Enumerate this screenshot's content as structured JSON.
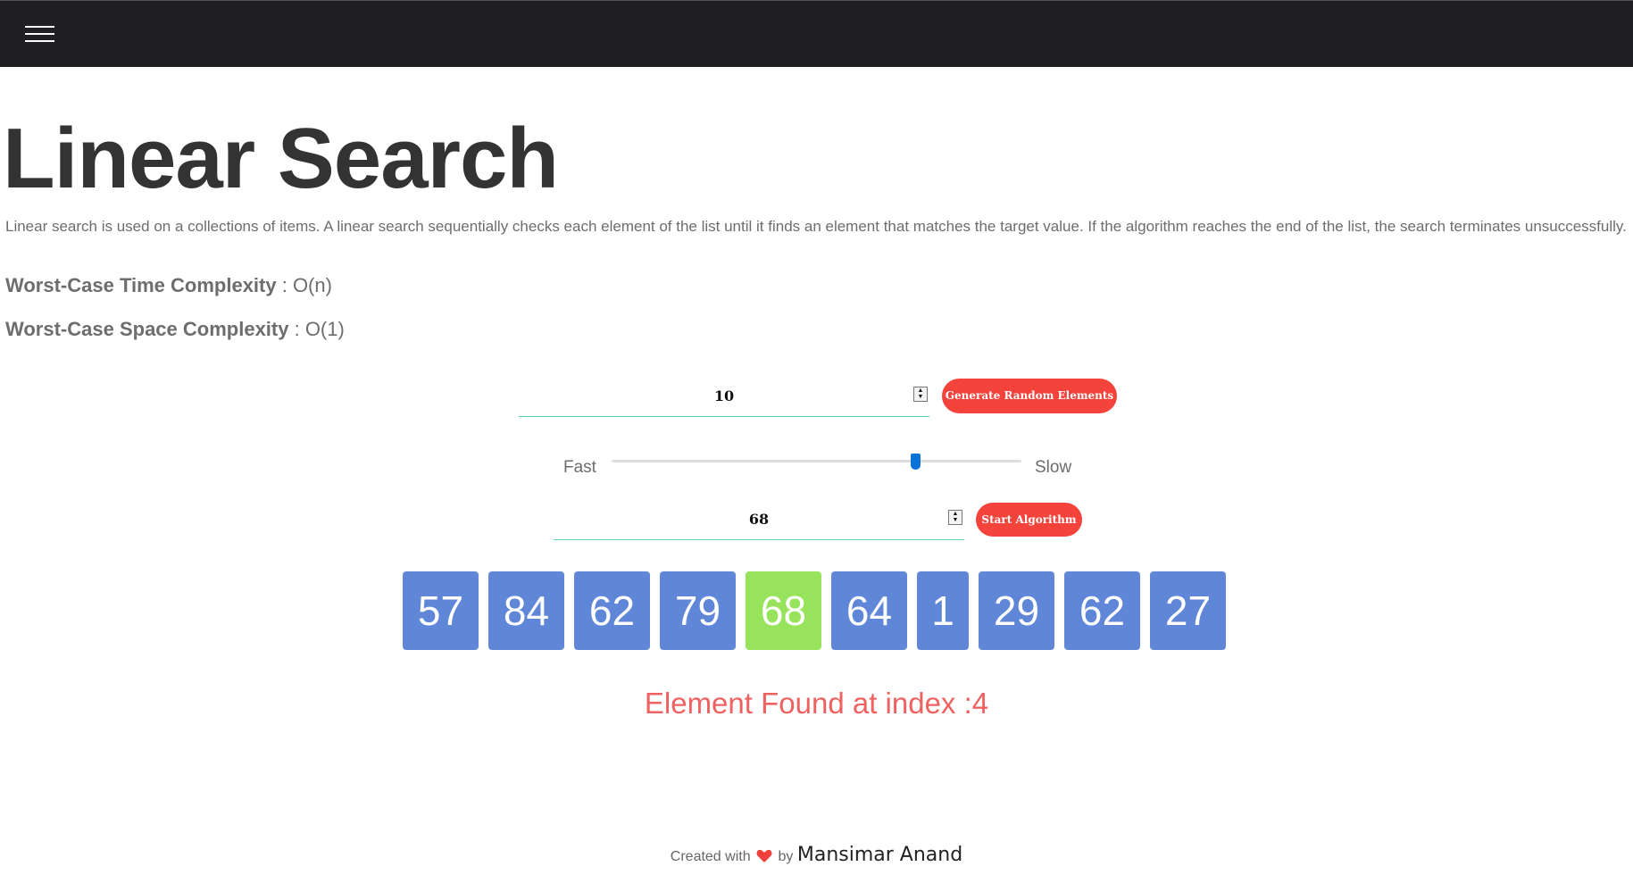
{
  "nav": {
    "menu_icon": "hamburger-menu-icon"
  },
  "page": {
    "title": "Linear Search",
    "description": "Linear search is used on a collections of items. A linear search sequentially checks each element of the list until it finds an element that matches the target value. If the algorithm reaches the end of the list, the search terminates unsuccessfully.",
    "time_label": "Worst-Case Time Complexity",
    "time_value": " : O(n)",
    "space_label": "Worst-Case Space Complexity",
    "space_value": " : O(1)"
  },
  "controls": {
    "size_value": "10",
    "generate_label": "Generate Random Elements",
    "fast_label": "Fast",
    "slow_label": "Slow",
    "speed_level": 0.74,
    "target_value": "68",
    "start_label": "Start Algorithm"
  },
  "array": {
    "values": [
      "57",
      "84",
      "62",
      "79",
      "68",
      "64",
      "1",
      "29",
      "62",
      "27"
    ],
    "found_index": 4,
    "colors": {
      "default": "#6086d8",
      "found": "#97e35b"
    }
  },
  "result": {
    "message": "Element Found at index :4"
  },
  "footer": {
    "prefix": "Created with",
    "heart_icon": "heart-icon",
    "middle": "by",
    "author": "Mansimar Anand"
  }
}
